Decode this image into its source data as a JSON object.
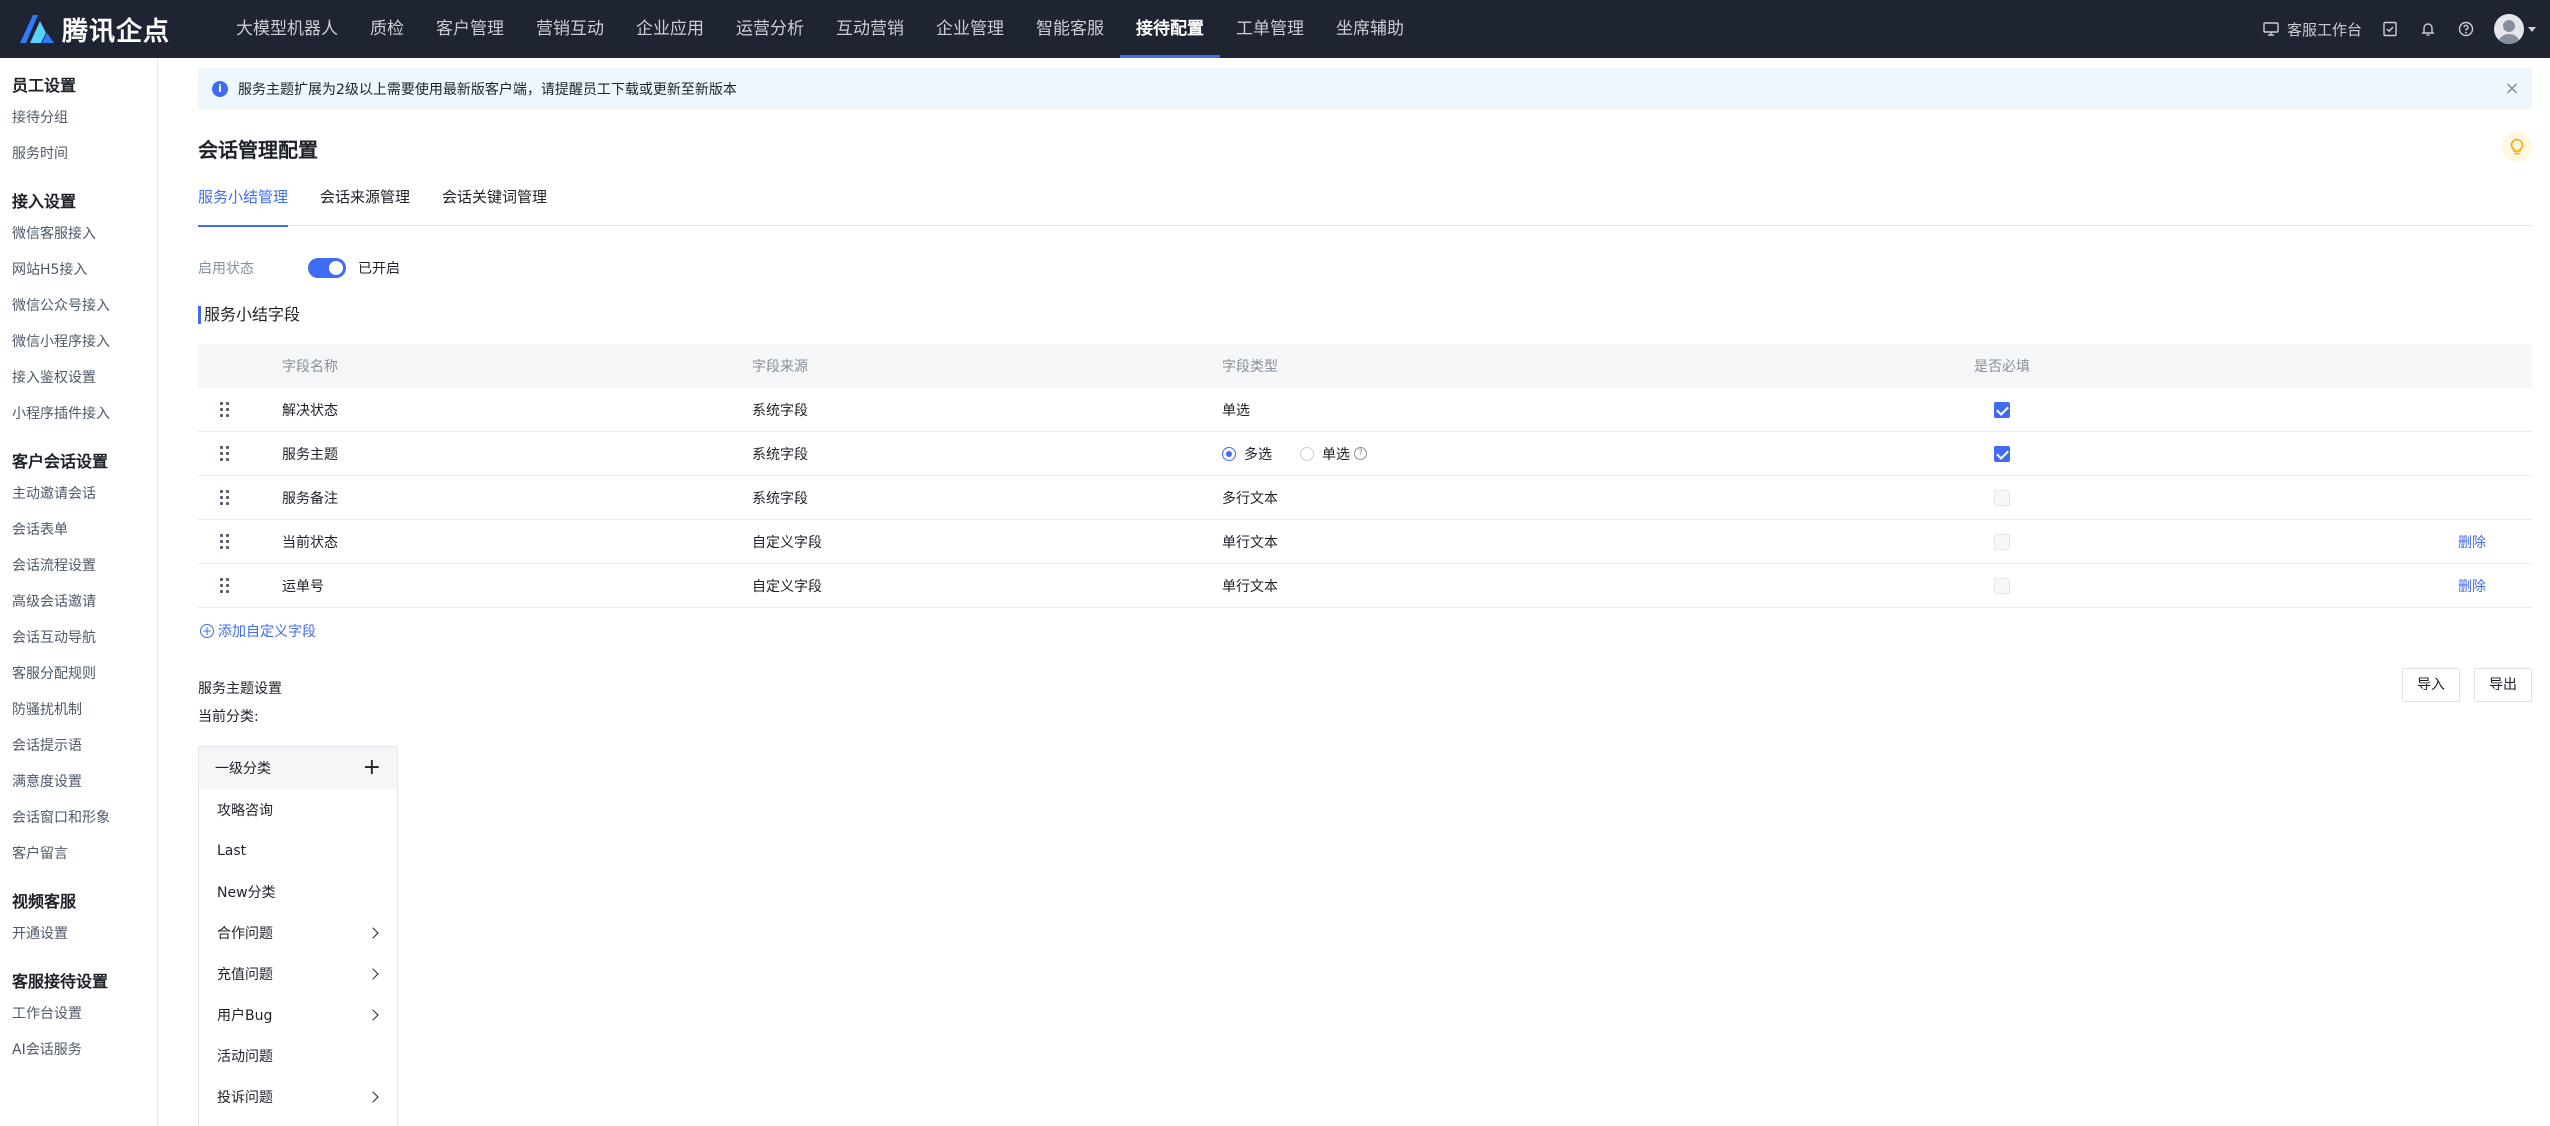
{
  "brand": {
    "name": "腾讯企点"
  },
  "nav": {
    "items": [
      "大模型机器人",
      "质检",
      "客户管理",
      "营销互动",
      "企业应用",
      "运营分析",
      "互动营销",
      "企业管理",
      "智能客服",
      "接待配置",
      "工单管理",
      "坐席辅助"
    ],
    "active_index": 9
  },
  "topright": {
    "workbench": "客服工作台"
  },
  "sidebar": {
    "groups": [
      {
        "title": "员工设置",
        "items": [
          "接待分组",
          "服务时间"
        ]
      },
      {
        "title": "接入设置",
        "items": [
          "微信客服接入",
          "网站H5接入",
          "微信公众号接入",
          "微信小程序接入",
          "接入鉴权设置",
          "小程序插件接入"
        ]
      },
      {
        "title": "客户会话设置",
        "items": [
          "主动邀请会话",
          "会话表单",
          "会话流程设置",
          "高级会话邀请",
          "会话互动导航",
          "客服分配规则",
          "防骚扰机制",
          "会话提示语",
          "满意度设置",
          "会话窗口和形象",
          "客户留言"
        ]
      },
      {
        "title": "视频客服",
        "items": [
          "开通设置"
        ]
      },
      {
        "title": "客服接待设置",
        "items": [
          "工作台设置",
          "AI会话服务"
        ]
      }
    ]
  },
  "notice": {
    "text": "服务主题扩展为2级以上需要使用最新版客户端，请提醒员工下载或更新至新版本"
  },
  "page": {
    "title": "会话管理配置"
  },
  "tabs": {
    "items": [
      "服务小结管理",
      "会话来源管理",
      "会话关键词管理"
    ],
    "active_index": 0
  },
  "status": {
    "label": "启用状态",
    "value": "已开启",
    "enabled": true
  },
  "fields_section": {
    "title": "服务小结字段",
    "headers": {
      "name": "字段名称",
      "source": "字段来源",
      "type": "字段类型",
      "required": "是否必填"
    },
    "rows": [
      {
        "name": "解决状态",
        "source": "系统字段",
        "type": "单选",
        "required": true,
        "required_disabled": false,
        "deletable": false
      },
      {
        "name": "服务主题",
        "source": "系统字段",
        "type_options": [
          "多选",
          "单选"
        ],
        "type_selected": 0,
        "required": true,
        "required_disabled": false,
        "deletable": false
      },
      {
        "name": "服务备注",
        "source": "系统字段",
        "type": "多行文本",
        "required": false,
        "required_disabled": true,
        "deletable": false
      },
      {
        "name": "当前状态",
        "source": "自定义字段",
        "type": "单行文本",
        "required": false,
        "required_disabled": true,
        "deletable": true
      },
      {
        "name": "运单号",
        "source": "自定义字段",
        "type": "单行文本",
        "required": false,
        "required_disabled": true,
        "deletable": true
      }
    ],
    "delete_label": "删除",
    "add_label": "添加自定义字段"
  },
  "theme": {
    "title": "服务主题设置",
    "current": "当前分类:",
    "import_label": "导入",
    "export_label": "导出",
    "level_title": "一级分类",
    "categories": [
      {
        "name": "攻略咨询",
        "has_children": false
      },
      {
        "name": "Last",
        "has_children": false
      },
      {
        "name": "New分类",
        "has_children": false
      },
      {
        "name": "合作问题",
        "has_children": true
      },
      {
        "name": "充值问题",
        "has_children": true
      },
      {
        "name": "用户Bug",
        "has_children": true
      },
      {
        "name": "活动问题",
        "has_children": false
      },
      {
        "name": "投诉问题",
        "has_children": true
      }
    ]
  },
  "colors": {
    "accent": "#3f6bf5",
    "topbar": "#1f2433",
    "notice_bg": "#eef6fe"
  }
}
